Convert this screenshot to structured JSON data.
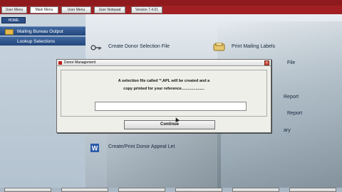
{
  "tabs": [
    {
      "label": "User Menu"
    },
    {
      "label": "Main Menu"
    },
    {
      "label": "User Menu"
    },
    {
      "label": "User Notepad"
    },
    {
      "label": "Version 7.4.01"
    }
  ],
  "home_label": "HOME",
  "sidebar": {
    "items": [
      {
        "label": "Mailing Bureau Output"
      },
      {
        "label": "Lookup Selections"
      }
    ]
  },
  "menu": {
    "create_donor_selection": "Create Donor Selection File",
    "print_mailing_labels": "Print Mailing Labels",
    "create_print_donor_appeal": "Create/Print Donor Appeal Let",
    "partial_file": "File",
    "partial_report": "Report",
    "partial_report2": "Report",
    "partial_ary": "ary"
  },
  "dialog": {
    "title": "Donor Management",
    "close": "x",
    "message_line1": "A selection file called '*.APL will be created and a",
    "message_line2": "copy printed for your reference.....................",
    "input_value": "",
    "continue_label": "Continue"
  },
  "colors": {
    "title_bar": "#8e1a1d",
    "sidebar_item": "#2f5690",
    "dialog_bg": "#efefea"
  }
}
